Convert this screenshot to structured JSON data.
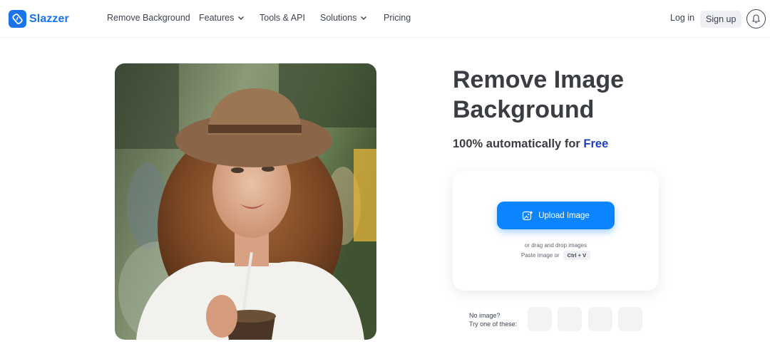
{
  "header": {
    "brand": "Slazzer",
    "nav": [
      {
        "label": "Remove Background",
        "has_dropdown": false
      },
      {
        "label": "Features",
        "has_dropdown": true
      },
      {
        "label": "Tools & API",
        "has_dropdown": false
      },
      {
        "label": "Solutions",
        "has_dropdown": true
      },
      {
        "label": "Pricing",
        "has_dropdown": false
      }
    ],
    "login_label": "Log in",
    "signup_label": "Sign up",
    "bell_icon": "bell-icon"
  },
  "hero": {
    "title": "Remove Image Background",
    "subtitle_main": "100% automatically for",
    "subtitle_highlight": "Free",
    "image_icon": "woman-portrait-photo"
  },
  "upload": {
    "button_label": "Upload Image",
    "button_icon": "image-add-icon",
    "drag_text": "or drag and drop images",
    "paste_text": "Paste image or",
    "shortcut": "Ctrl + V"
  },
  "samples": {
    "line1": "No image?",
    "line2": "Try one of these:"
  },
  "colors": {
    "brand": "#1a73e8",
    "upload_button": "#0a84ff",
    "free_highlight": "#1b3fbf",
    "title_text": "#3a3d42"
  }
}
